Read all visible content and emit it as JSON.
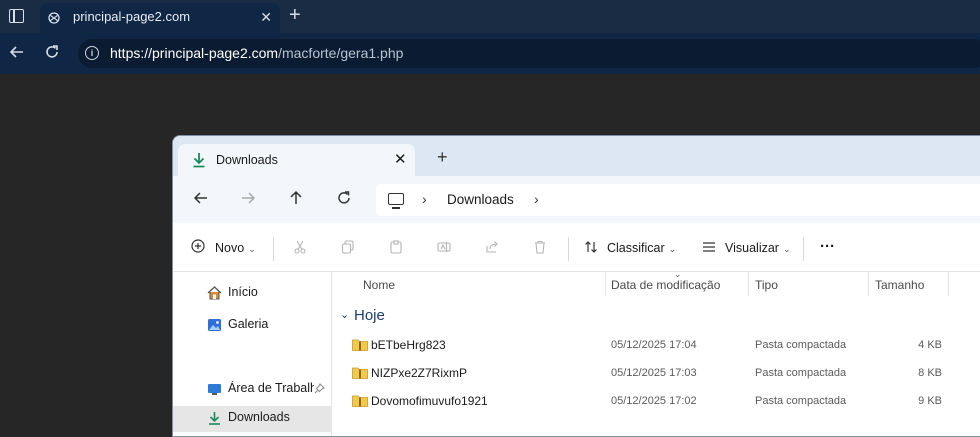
{
  "browser": {
    "tab_title": "principal-page2.com",
    "tab_close": "✕",
    "new_tab": "+",
    "url_host": "https://principal-page2.com",
    "url_path": "/macforte/gera1.php"
  },
  "explorer": {
    "tab_title": "Downloads",
    "tab_close": "✕",
    "new_tab": "+",
    "breadcrumb": {
      "sep": "›",
      "folder": "Downloads"
    },
    "toolbar": {
      "new_label": "Novo",
      "sort_label": "Classificar",
      "view_label": "Visualizar",
      "more_label": "···"
    },
    "sidebar": {
      "items": [
        {
          "label": "Início",
          "icon": "home-icon"
        },
        {
          "label": "Galeria",
          "icon": "gallery-icon"
        },
        {
          "label": "Área de Trabalho",
          "icon": "desktop-icon"
        },
        {
          "label": "Downloads",
          "icon": "downloads-icon"
        }
      ]
    },
    "columns": {
      "name": "Nome",
      "date": "Data de modificação",
      "type": "Tipo",
      "size": "Tamanho"
    },
    "group": "Hoje",
    "files": [
      {
        "name": "bETbeHrg823",
        "date": "05/12/2025 17:04",
        "type": "Pasta compactada",
        "size": "4 KB"
      },
      {
        "name": "NIZPxe2Z7RixmP",
        "date": "05/12/2025 17:03",
        "type": "Pasta compactada",
        "size": "8 KB"
      },
      {
        "name": "Dovomofimuvufo1921",
        "date": "05/12/2025 17:02",
        "type": "Pasta compactada",
        "size": "9 KB"
      }
    ]
  },
  "colors": {
    "browser_toolbar": "#0f2745",
    "explorer_tabbar": "#dce7f3",
    "folder_zip": "#e8b93b",
    "accent_blue": "#1f3b6f"
  }
}
